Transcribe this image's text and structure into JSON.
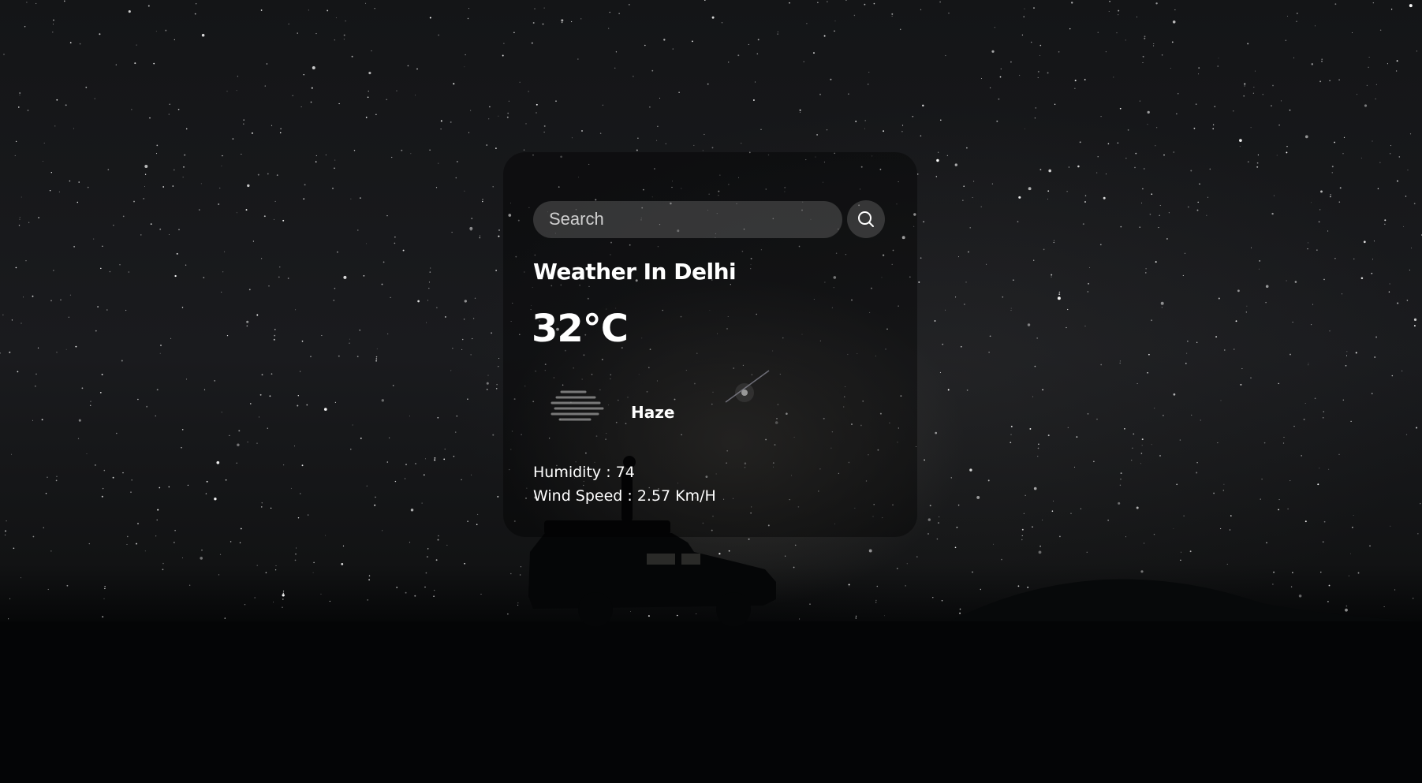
{
  "background": {
    "description_icon": "starry-night-background"
  },
  "search": {
    "placeholder": "Search",
    "value": "",
    "icon": "search-icon"
  },
  "weather": {
    "title": "Weather In Delhi",
    "temperature": "32°C",
    "condition_icon": "haze-icon",
    "condition": "Haze",
    "humidity": "Humidity : 74",
    "wind_speed": "Wind Speed : 2.57 Km/H"
  }
}
